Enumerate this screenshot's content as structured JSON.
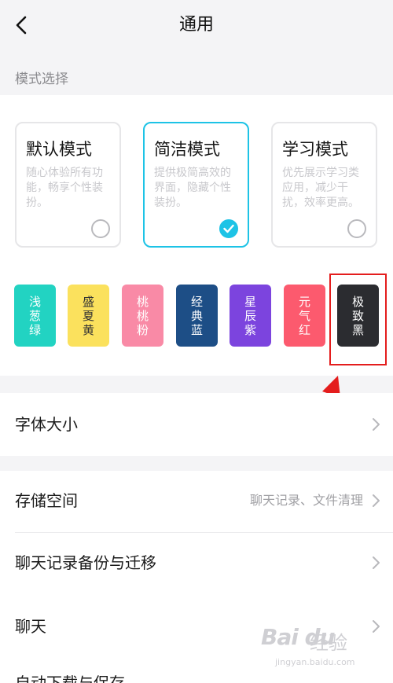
{
  "header": {
    "title": "通用"
  },
  "mode_section": {
    "label": "模式选择"
  },
  "modes": [
    {
      "title": "默认模式",
      "desc": "随心体验所有功能，畅享个性装扮。",
      "selected": false
    },
    {
      "title": "简洁模式",
      "desc": "提供极简高效的界面，隐藏个性装扮。",
      "selected": true
    },
    {
      "title": "学习模式",
      "desc": "优先展示学习类应用，减少干扰，效率更高。",
      "selected": false
    }
  ],
  "themes": [
    {
      "name": "浅葱绿",
      "color": "#22d3c2"
    },
    {
      "name": "盛夏黄",
      "color": "#fbe15d"
    },
    {
      "name": "桃桃粉",
      "color": "#f98aa6"
    },
    {
      "name": "经典蓝",
      "color": "#1d4e86"
    },
    {
      "name": "星辰紫",
      "color": "#7c44de"
    },
    {
      "name": "元气红",
      "color": "#fc5a6e"
    },
    {
      "name": "极致黑",
      "color": "#2b2c30"
    }
  ],
  "rows": {
    "font_size": {
      "label": "字体大小"
    },
    "storage": {
      "label": "存储空间",
      "value": "聊天记录、文件清理"
    },
    "backup": {
      "label": "聊天记录备份与迁移"
    },
    "chat": {
      "label": "聊天"
    },
    "partial": {
      "label": "自动下载与保存"
    }
  },
  "watermark": {
    "logo": "Bai du",
    "jingyan": "经验",
    "url": "jingyan.baidu.com"
  },
  "colors": {
    "accent": "#1dc3e6",
    "highlight": "#e41d1d"
  }
}
